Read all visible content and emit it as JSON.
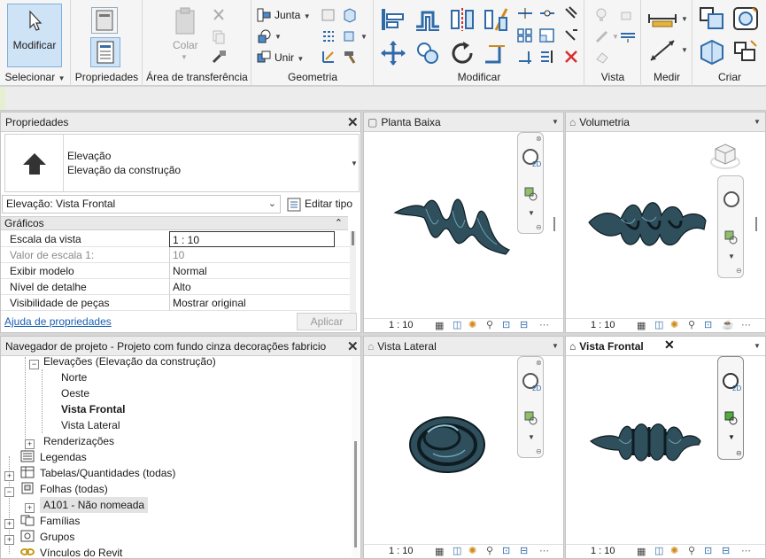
{
  "ribbon": {
    "modify_label": "Modificar",
    "color_label": "Colar",
    "join_label": "Junta",
    "unite_label": "Unir",
    "panels": {
      "select": "Selecionar",
      "properties": "Propriedades",
      "clipboard": "Área de transferência",
      "geometry": "Geometria",
      "modify": "Modificar",
      "view": "Vista",
      "measure": "Medir",
      "create": "Criar"
    }
  },
  "properties": {
    "title": "Propriedades",
    "type_line1": "Elevação",
    "type_line2": "Elevação da construção",
    "selector_value": "Elevação: Vista Frontal",
    "edit_type": "Editar tipo",
    "section": "Gráficos",
    "rows": [
      {
        "key": "Escala da vista",
        "value": "1 : 10"
      },
      {
        "key": "Valor de escala    1:",
        "value": "10"
      },
      {
        "key": "Exibir modelo",
        "value": "Normal"
      },
      {
        "key": "Nível de detalhe",
        "value": "Alto"
      },
      {
        "key": "Visibilidade de peças",
        "value": "Mostrar original"
      }
    ],
    "help_link": "Ajuda de propriedades",
    "apply": "Aplicar"
  },
  "browser": {
    "title": "Navegador de projeto - Projeto com fundo cinza decorações fabricio",
    "items": [
      {
        "label": "Elevações (Elevação da construção)"
      },
      {
        "label": "Norte"
      },
      {
        "label": "Oeste"
      },
      {
        "label": "Vista Frontal"
      },
      {
        "label": "Vista Lateral"
      },
      {
        "label": "Renderizações"
      },
      {
        "label": "Legendas"
      },
      {
        "label": "Tabelas/Quantidades (todas)"
      },
      {
        "label": "Folhas (todas)"
      },
      {
        "label": "A101 - Não nomeada"
      },
      {
        "label": "Famílias"
      },
      {
        "label": "Grupos"
      },
      {
        "label": "Vínculos do Revit"
      }
    ]
  },
  "views": [
    {
      "title": "Planta Baixa",
      "scale": "1 : 10"
    },
    {
      "title": "Volumetria",
      "scale": "1 : 10"
    },
    {
      "title": "Vista Lateral",
      "scale": "1 : 10"
    },
    {
      "title": "Vista Frontal",
      "scale": "1 : 10"
    }
  ],
  "colors": {
    "model": "#2f4f5c",
    "model_dark": "#0e1c22",
    "accent": "#3a7fc1",
    "link": "#1a5fb4"
  }
}
